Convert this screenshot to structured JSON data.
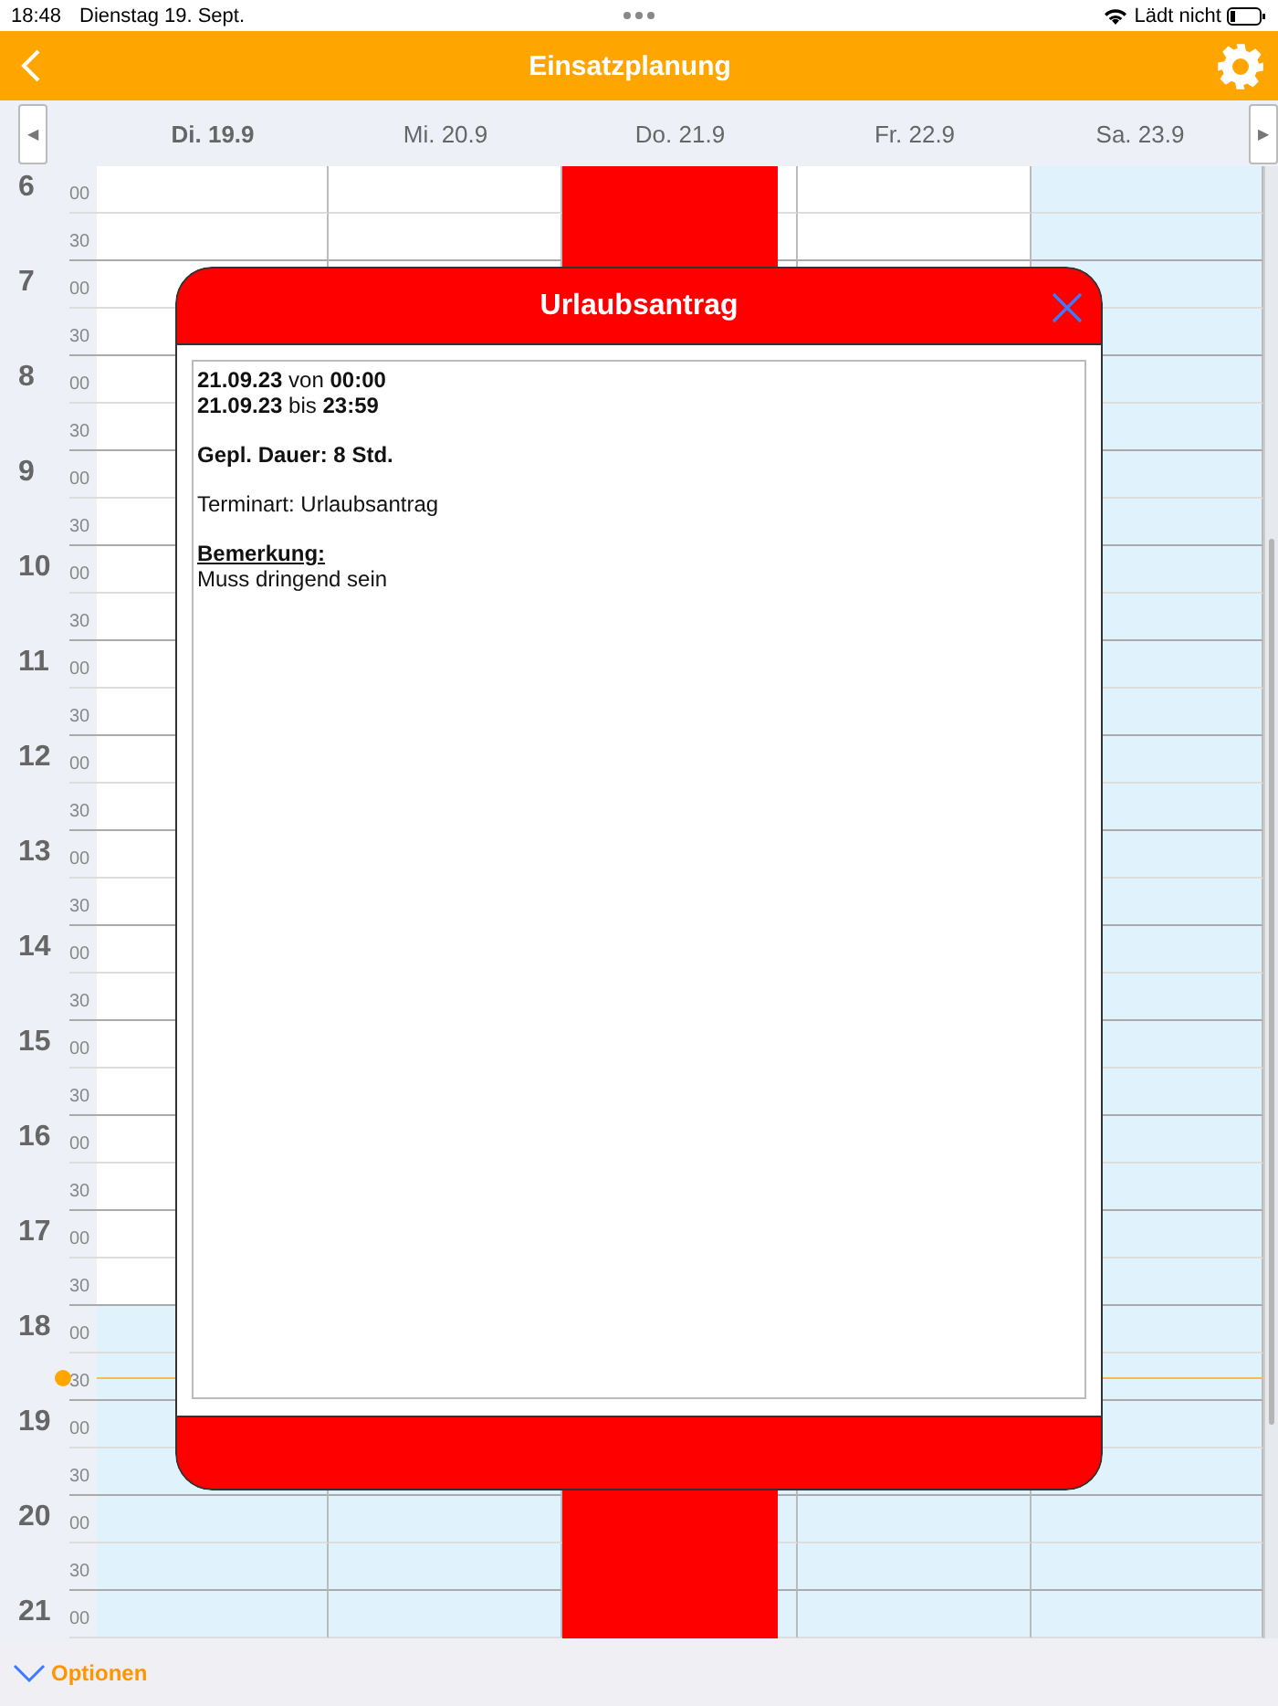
{
  "status_bar": {
    "time": "18:48",
    "date": "Dienstag 19. Sept.",
    "battery_text": "Lädt nicht"
  },
  "header": {
    "title": "Einsatzplanung"
  },
  "day_bar": {
    "prev": "◀",
    "next": "▶",
    "days": [
      {
        "label": "Di. 19.9",
        "selected": true,
        "shaded": false,
        "event": false
      },
      {
        "label": "Mi. 20.9",
        "selected": false,
        "shaded": false,
        "event": false
      },
      {
        "label": "Do. 21.9",
        "selected": false,
        "shaded": false,
        "event": true
      },
      {
        "label": "Fr. 22.9",
        "selected": false,
        "shaded": false,
        "event": false
      },
      {
        "label": "Sa. 23.9",
        "selected": false,
        "shaded": true,
        "event": false
      }
    ]
  },
  "hours": [
    {
      "label": "6",
      "minutes": [
        "00",
        "30"
      ],
      "shaded": false,
      "now": false
    },
    {
      "label": "7",
      "minutes": [
        "00",
        "30"
      ],
      "shaded": false,
      "now": false
    },
    {
      "label": "8",
      "minutes": [
        "00",
        "30"
      ],
      "shaded": false,
      "now": false
    },
    {
      "label": "9",
      "minutes": [
        "00",
        "30"
      ],
      "shaded": false,
      "now": false
    },
    {
      "label": "10",
      "minutes": [
        "00",
        "30"
      ],
      "shaded": false,
      "now": false
    },
    {
      "label": "11",
      "minutes": [
        "00",
        "30"
      ],
      "shaded": false,
      "now": false
    },
    {
      "label": "12",
      "minutes": [
        "00",
        "30"
      ],
      "shaded": false,
      "now": false
    },
    {
      "label": "13",
      "minutes": [
        "00",
        "30"
      ],
      "shaded": false,
      "now": false
    },
    {
      "label": "14",
      "minutes": [
        "00",
        "30"
      ],
      "shaded": false,
      "now": false
    },
    {
      "label": "15",
      "minutes": [
        "00",
        "30"
      ],
      "shaded": false,
      "now": false
    },
    {
      "label": "16",
      "minutes": [
        "00",
        "30"
      ],
      "shaded": false,
      "now": false
    },
    {
      "label": "17",
      "minutes": [
        "00",
        "30"
      ],
      "shaded": false,
      "now": false
    },
    {
      "label": "18",
      "minutes": [
        "00",
        "30"
      ],
      "shaded": true,
      "now": true
    },
    {
      "label": "19",
      "minutes": [
        "00",
        "30"
      ],
      "shaded": true,
      "now": false
    },
    {
      "label": "20",
      "minutes": [
        "00",
        "30"
      ],
      "shaded": true,
      "now": false
    },
    {
      "label": "21",
      "minutes": [
        "00"
      ],
      "shaded": true,
      "now": false
    }
  ],
  "dialog": {
    "title": "Urlaubsantrag",
    "paragraphs": [
      [
        {
          "text": "**21.09.23** von **00:00**",
          "kind": "plain"
        },
        {
          "text": "**21.09.23** bis **23:59**",
          "kind": "plain"
        }
      ],
      [
        {
          "text": "Gepl. Dauer: 8 Std.",
          "kind": "bold"
        }
      ],
      [
        {
          "text": "Terminart: Urlaubsantrag",
          "kind": "plain"
        }
      ],
      [
        {
          "text": "Bemerkung:",
          "kind": "heading"
        },
        {
          "text": "Muss dringend sein",
          "kind": "plain"
        }
      ]
    ]
  },
  "footer": {
    "label": "Optionen"
  }
}
